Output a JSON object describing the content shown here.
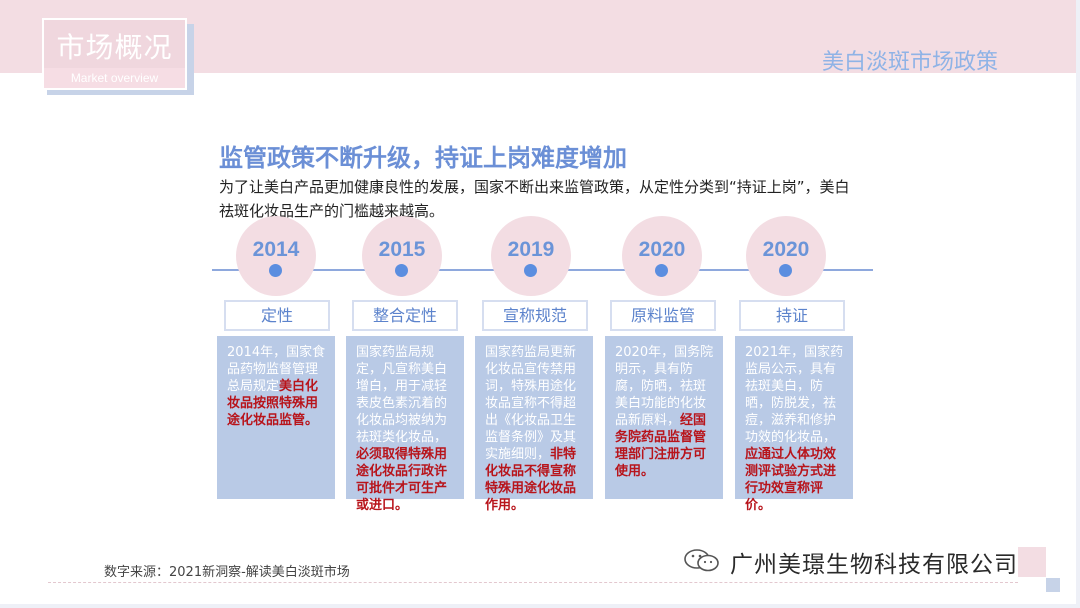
{
  "badge": {
    "title": "市场概况",
    "subtitle": "Market overview"
  },
  "section_title": "美白淡斑市场政策",
  "headline": "监管政策不断升级，持证上岗难度增加",
  "intro": "为了让美白产品更加健康良性的发展，国家不断出来监管政策，从定性分类到“持证上岗”，美白祛斑化妆品生产的门槛越来越高。",
  "timeline": [
    {
      "year": "2014",
      "label": "定性",
      "text": "2014年，国家食品药物监督管理总局规定",
      "highlight": "美白化妆品按照特殊用途化妆品监管。",
      "text_after": ""
    },
    {
      "year": "2015",
      "label": "整合定性",
      "text": "国家药监局规定，凡宣称美白增白，用于减轻表皮色素沉着的化妆品均被纳为祛斑类化妆品，",
      "highlight": "必须取得特殊用途化妆品行政许可批件才可生产或进口。",
      "text_after": ""
    },
    {
      "year": "2019",
      "label": "宣称规范",
      "text": "国家药监局更新化妆品宣传禁用词，特殊用途化妆品宣称不得超出《化妆品卫生监督条例》及其实施细则，",
      "highlight": "非特化妆品不得宣称特殊用途化妆品作用。",
      "text_after": ""
    },
    {
      "year": "2020",
      "label": "原料监管",
      "text": "2020年，国务院明示，具有防腐，防晒，祛斑美白功能的化妆品新原料，",
      "highlight": "经国务院药品监督管理部门注册方可使用。",
      "text_after": ""
    },
    {
      "year": "2020",
      "label": "持证",
      "text": "2021年，国家药监局公示，具有祛斑美白，防晒，防脱发，祛痘，滋养和修护功效的化妆品，",
      "highlight": "应通过人体功效测评试验方式进行功效宣称评价。",
      "text_after": ""
    }
  ],
  "source": "数字来源：2021新洞察-解读美白淡斑市场",
  "company": "广州美璟生物科技有限公司",
  "colors": {
    "accent": "#6b8fd6",
    "pink": "#f3dde3",
    "card": "#b9cae6",
    "highlight": "#b8141b"
  }
}
